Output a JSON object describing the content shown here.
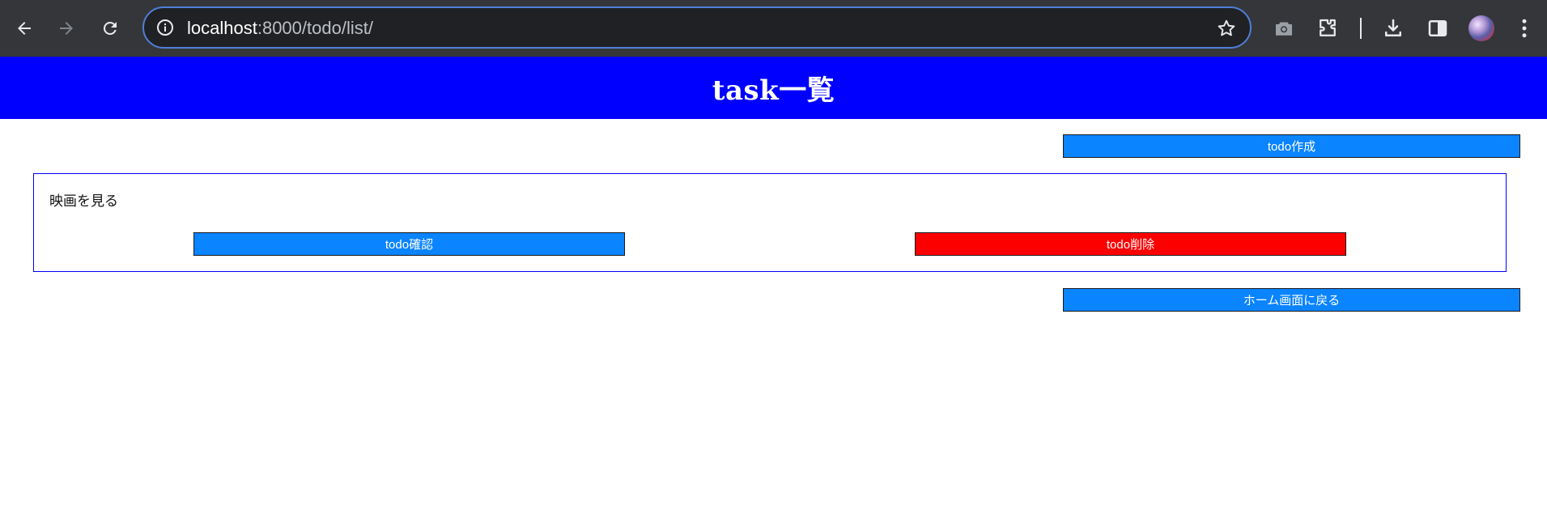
{
  "browser": {
    "url_host": "localhost",
    "url_path": ":8000/todo/list/"
  },
  "header": {
    "title": "task一覧",
    "background_color": "#0000ff"
  },
  "actions": {
    "create_label": "todo作成",
    "home_label": "ホーム画面に戻る"
  },
  "todos": [
    {
      "title": "映画を見る",
      "detail_label": "todo確認",
      "delete_label": "todo削除"
    }
  ],
  "colors": {
    "primary_button": "#0a84ff",
    "danger_button": "#fc0000",
    "card_border": "#0000ff"
  }
}
